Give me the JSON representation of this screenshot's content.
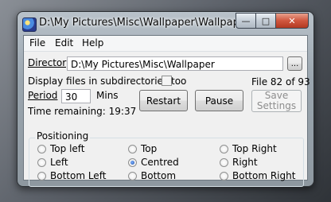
{
  "window": {
    "title": "D:\\My Pictures\\Misc\\Wallpaper\\Wallpaper (...",
    "minimize_glyph": "—",
    "maximize_glyph": "□",
    "close_glyph": "✕"
  },
  "menu": [
    "File",
    "Edit",
    "Help"
  ],
  "directory": {
    "label": "Directory",
    "value": "D:\\My Pictures\\Misc\\Wallpaper",
    "browse_label": "..."
  },
  "subdirs": {
    "label": "Display files in subdirectories too",
    "checked": false
  },
  "file_status": "File 82 of 93",
  "period": {
    "label": "Period",
    "value": "30",
    "unit": "Mins"
  },
  "time_remaining": "Time remaining: 19:37",
  "buttons": {
    "restart": "Restart",
    "pause": "Pause",
    "save_line1": "Save",
    "save_line2": "Settings"
  },
  "positioning": {
    "title": "Positioning",
    "options": [
      "Top left",
      "Top",
      "Top Right",
      "Left",
      "Centred",
      "Right",
      "Bottom Left",
      "Bottom",
      "Bottom Right"
    ],
    "selected": "Centred"
  }
}
